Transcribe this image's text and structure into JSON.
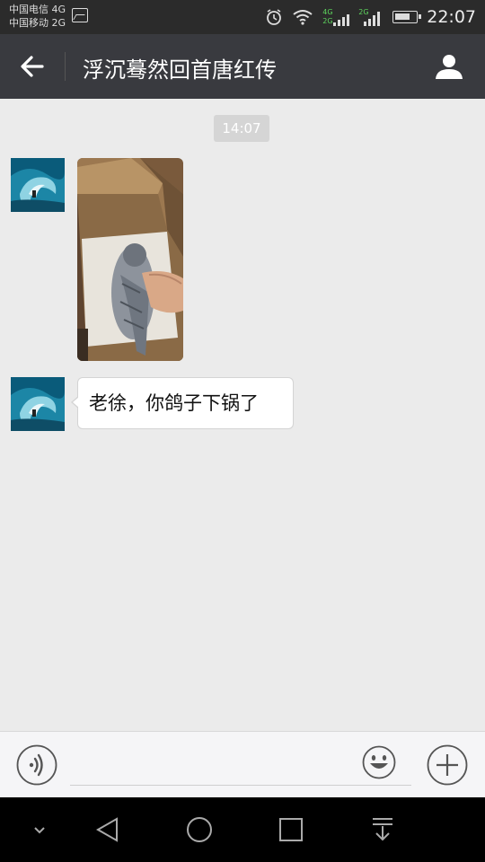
{
  "status_bar": {
    "carrier_1": "中国电信 4G",
    "carrier_2": "中国移动 2G",
    "net_badge_1": "4G",
    "net_badge_2": "2G",
    "time": "22:07"
  },
  "header": {
    "title": "浮沉蓦然回首唐红传"
  },
  "chat": {
    "timestamp": "14:07",
    "messages": [
      {
        "type": "image",
        "description_icon": "photo-message"
      },
      {
        "type": "text",
        "text": "老徐，你鸽子下锅了"
      }
    ]
  },
  "input_bar": {
    "placeholder": ""
  },
  "colors": {
    "title_bar_bg": "#393a3f",
    "chat_bg": "#ebebeb",
    "status_bar_bg": "#2b2b2b"
  }
}
